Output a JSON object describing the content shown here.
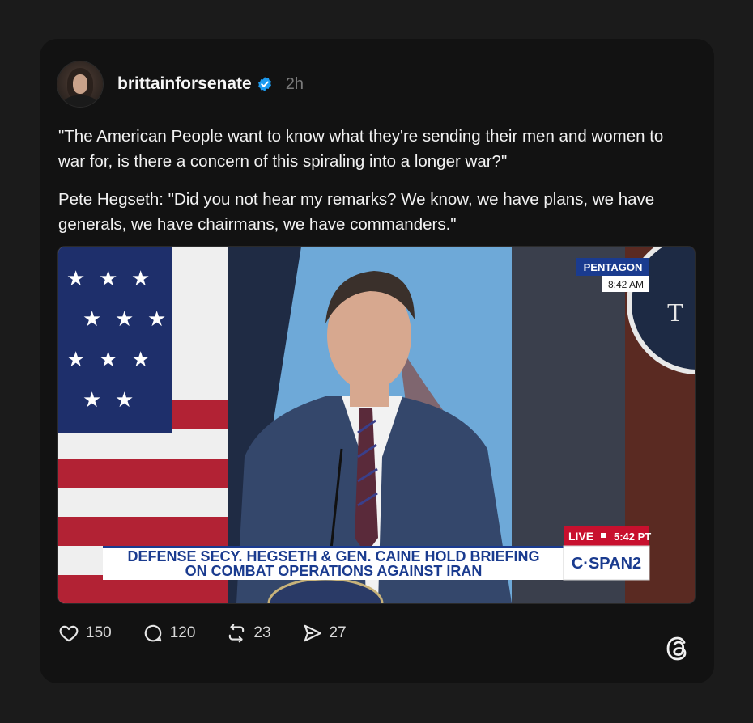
{
  "post": {
    "username": "brittainforsenate",
    "time": "2h",
    "paragraph_1": "\"The American People want to know what they're sending their men and women to war for, is there a concern of this spiraling into a longer war?\"",
    "paragraph_2": "Pete Hegseth: \"Did you not hear my remarks? We know, we have plans, we have generals, we have chairmans, we have commanders.\""
  },
  "media": {
    "network_tag": "PENTAGON",
    "network_time": "8:42 AM",
    "live_label": "LIVE",
    "live_time": "5:42 PT",
    "chyron_line_1": "DEFENSE SECY. HEGSETH & GEN. CAINE HOLD BRIEFING",
    "chyron_line_2": "ON COMBAT OPERATIONS AGAINST IRAN",
    "channel": "C·SPAN2"
  },
  "actions": {
    "likes": "150",
    "replies": "120",
    "reposts": "23",
    "shares": "27"
  },
  "icons": {
    "like": "heart-icon",
    "reply": "comment-icon",
    "repost": "repost-icon",
    "share": "send-icon",
    "brand": "threads-logo-icon",
    "verified": "verified-badge-icon"
  },
  "colors": {
    "background": "#1b1b1b",
    "card": "#121212",
    "verified_blue": "#1d9bf0",
    "chyron_blue": "#1a3b8f",
    "live_red": "#c8102e"
  }
}
